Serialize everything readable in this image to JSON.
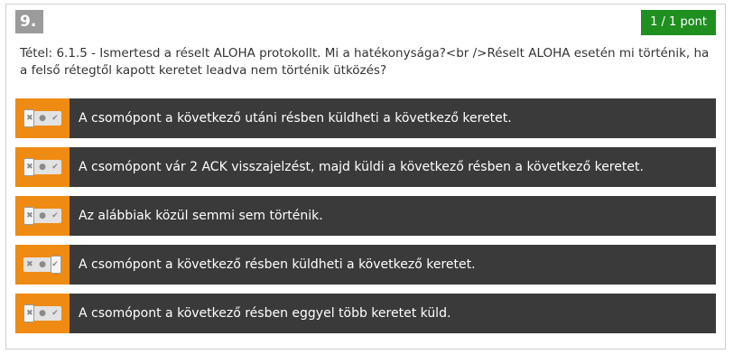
{
  "question": {
    "number": "9.",
    "score": "1 / 1 pont",
    "text": "Tétel: 6.1.5 - Ismertesd a réselt ALOHA protokollt. Mi a hatékonysága?<br />Réselt ALOHA esetén mi történik, ha a felső rétegtől kapott keretet leadva nem történik ütközés?"
  },
  "toggle_icons": {
    "cross": "✖",
    "dot": "●",
    "check": "✔"
  },
  "answers": [
    {
      "label": "A csomópont a következő utáni résben küldheti a következő keretet.",
      "state": "cross"
    },
    {
      "label": "A csomópont vár 2 ACK visszajelzést, majd küldi a következő résben a következő keretet.",
      "state": "cross"
    },
    {
      "label": "Az alábbiak közül semmi sem történik.",
      "state": "cross"
    },
    {
      "label": "A csomópont a következő résben küldheti a következő keretet.",
      "state": "check"
    },
    {
      "label": "A csomópont a következő résben eggyel több keretet küld.",
      "state": "cross"
    }
  ],
  "colors": {
    "accent_orange": "#ef8b12",
    "answer_bg": "#3a3a3a",
    "score_green": "#1f8f1f",
    "number_gray": "#9b9b9b"
  }
}
